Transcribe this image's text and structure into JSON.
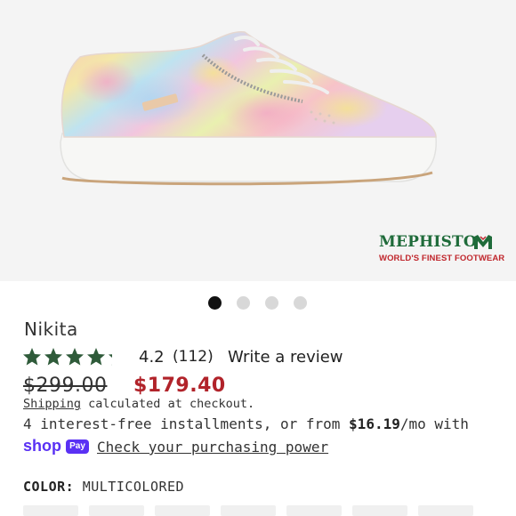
{
  "brand": {
    "name": "MEPHISTO",
    "tagline": "WORLD'S FINEST FOOTWEAR",
    "colors": {
      "green": "#1f6b3a",
      "red": "#c0272d"
    }
  },
  "carousel": {
    "total": 4,
    "active_index": 0
  },
  "product": {
    "title": "Nikita",
    "rating_value": "4.2",
    "rating_count": "(112)",
    "rating_stars": 4.2,
    "write_review_label": "Write a review",
    "original_price": "$299.00",
    "sale_price": "$179.40",
    "sale_color": "#b1232a"
  },
  "shipping": {
    "link_label": "Shipping",
    "text": " calculated at checkout."
  },
  "installments": {
    "prefix": "4 interest-free installments, or from ",
    "amount": "$16.19",
    "suffix": "/mo with"
  },
  "shoppay": {
    "shop": "shop",
    "pay": "Pay",
    "link_label": "Check your purchasing power",
    "accent": "#5a31f4"
  },
  "color_option": {
    "label": "COLOR:",
    "value": "MULTICOLORED"
  },
  "icons": {
    "star": "star-icon",
    "logo": "mephisto-m-icon"
  }
}
